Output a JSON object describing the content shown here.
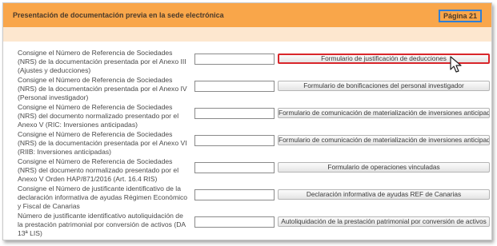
{
  "header": {
    "title": "Presentación de documentación previa en la sede electrónica",
    "page_label": "Página 21",
    "badge_color": "#2f7fd6",
    "accent_color": "#f9a64a"
  },
  "rows": [
    {
      "description": "Consigne el Número de Referencia de Sociedades (NRS) de la documentación presentada por el Anexo III (Ajustes y deducciones)",
      "nrs_value": "",
      "button_label": "Formulario de justificación de deducciones",
      "highlighted": true
    },
    {
      "description": "Consigne el Número de Referencia de Sociedades (NRS) de la documentación presentada por el Anexo IV (Personal investigador)",
      "nrs_value": "",
      "button_label": "Formulario de bonificaciones del personal investigador",
      "highlighted": false
    },
    {
      "description": "Consigne el Número de Referencia de Sociedades (NRS) del documento normalizado presentado por el Anexo V (RIC: Inversiones anticipadas)",
      "nrs_value": "",
      "button_label": "Formulario de comunicación de materialización de inversiones anticipadas",
      "highlighted": false
    },
    {
      "description": "Consigne el Número de Referencia de Sociedades (NRS) de la documentación presentada por el Anexo VI (RIIB: Inversiones anticipadas)",
      "nrs_value": "",
      "button_label": "Formulario de comunicación de materialización de inversiones anticipadas",
      "highlighted": false
    },
    {
      "description": "Consigne el Número de Referencia de Sociedades (NRS) del documento normalizado presentado por el Anexo V Orden HAP/871/2016 (Art. 16.4 RIS)",
      "nrs_value": "",
      "button_label": "Formulario de operaciones vinculadas",
      "highlighted": false
    },
    {
      "description": "Consigne el Número de justificante identificativo de la declaración informativa de ayudas Régimen Económico y Fiscal de Canarias",
      "nrs_value": "",
      "button_label": "Declaración informativa de ayudas REF de Canarias",
      "highlighted": false
    },
    {
      "description": "Número de justificante identificativo autoliquidación de la prestación patrimonial por conversión de activos (DA 13ª LIS)",
      "nrs_value": "",
      "button_label": "Autoliquidación de la prestación patrimonial por conversión de activos",
      "highlighted": false
    }
  ],
  "icons": {
    "cursor": "mouse-pointer-icon"
  }
}
